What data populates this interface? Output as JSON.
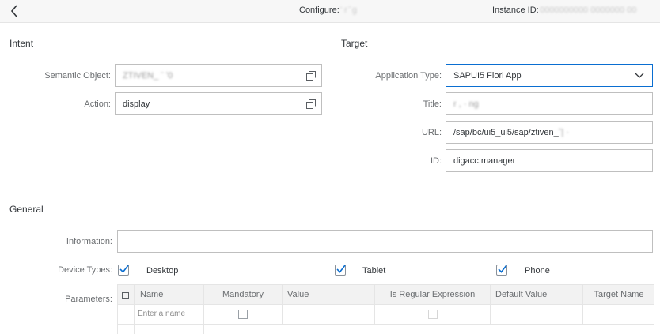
{
  "header": {
    "configure_label": "Configure:",
    "configure_value": "' r ̌ g",
    "instance_label": "Instance ID:",
    "instance_value": "0000000000 0000000 00"
  },
  "intent": {
    "title": "Intent",
    "semantic_object_label": "Semantic Object:",
    "semantic_object_value": "ZTIVEN_ ¨ ʹ0",
    "action_label": "Action:",
    "action_value": "display"
  },
  "target": {
    "title": "Target",
    "app_type_label": "Application Type:",
    "app_type_value": "SAPUI5 Fiori App",
    "title_label": "Title:",
    "title_value": "r ,  ·  ng",
    "url_label": "URL:",
    "url_value": "/sap/bc/ui5_ui5/sap/ztiven_",
    "url_value_hidden": "ˆ|  ·",
    "id_label": "ID:",
    "id_value": "digacc.manager"
  },
  "general": {
    "title": "General",
    "information_label": "Information:",
    "information_value": "",
    "device_types_label": "Device Types:",
    "devices": [
      {
        "label": "Desktop",
        "checked": true
      },
      {
        "label": "Tablet",
        "checked": true
      },
      {
        "label": "Phone",
        "checked": true
      }
    ],
    "parameters_label": "Parameters:"
  },
  "parameters_table": {
    "columns": [
      "Name",
      "Mandatory",
      "Value",
      "Is Regular Expression",
      "Default Value",
      "Target Name"
    ],
    "new_row_placeholder": "Enter a name"
  },
  "colors": {
    "focus_border": "#0a6ed1",
    "checkmark": "#0a6ed1",
    "label": "#6a6d70",
    "text": "#32363a"
  }
}
